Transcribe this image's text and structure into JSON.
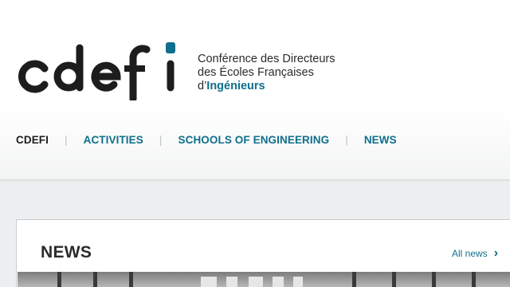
{
  "header": {
    "logo_text": "cdefi",
    "tagline": {
      "line1": "Conférence des Directeurs",
      "line2": "des Écoles Françaises",
      "line3_prefix": "d’",
      "line3_accent": "Ingénieurs"
    }
  },
  "nav": {
    "items": [
      {
        "label": "CDEFI",
        "current": true
      },
      {
        "label": "ACTIVITIES"
      },
      {
        "label": "SCHOOLS OF ENGINEERING"
      },
      {
        "label": "NEWS"
      }
    ],
    "separator": "|"
  },
  "news_panel": {
    "title": "NEWS",
    "all_news_label": "All news",
    "all_news_icon": "chevron-right-icon"
  },
  "colors": {
    "accent": "#0f6f8c",
    "text_dark": "#1d1d1d",
    "page_bg": "#eceeef"
  }
}
